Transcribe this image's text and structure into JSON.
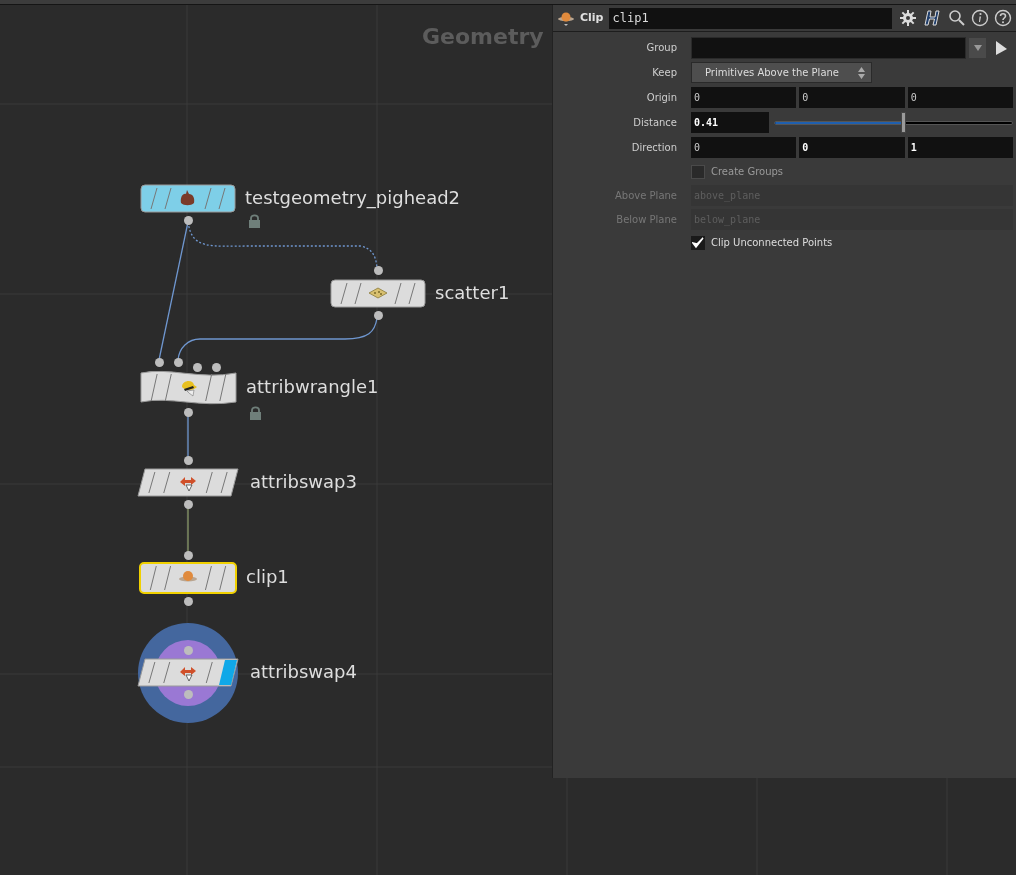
{
  "network": {
    "title": "Geometry",
    "nodes": [
      {
        "kind": "testgeometry",
        "label": "testgeometry_pighead2",
        "color": "#7ecfe8",
        "locked": true,
        "selected": false,
        "display": false
      },
      {
        "kind": "scatter",
        "label": "scatter1",
        "color": "#dcdcdc",
        "locked": false,
        "selected": false,
        "display": false
      },
      {
        "kind": "wrangle",
        "label": "attribwrangle1",
        "color": "#dcdcdc",
        "locked": true,
        "selected": false,
        "display": false
      },
      {
        "kind": "swap",
        "label": "attribswap3",
        "color": "#dcdcdc",
        "locked": false,
        "selected": false,
        "display": false
      },
      {
        "kind": "clip",
        "label": "clip1",
        "color": "#dcdcdc",
        "locked": false,
        "selected": true,
        "display": false
      },
      {
        "kind": "swap",
        "label": "attribswap4",
        "color": "#dcdcdc",
        "locked": false,
        "selected": false,
        "display": true
      }
    ]
  },
  "parameters": {
    "node_type": "Clip",
    "node_name": "clip1",
    "rows": [
      {
        "kind": "group",
        "label": "Group",
        "disabled": false
      },
      {
        "kind": "menu",
        "label": "Keep",
        "value": "Primitives Above the Plane",
        "disabled": false
      },
      {
        "kind": "vector",
        "label": "Origin",
        "disabled": false,
        "components": [
          {
            "value": "0",
            "modified": false
          },
          {
            "value": "0",
            "modified": false
          },
          {
            "value": "0",
            "modified": false
          }
        ]
      },
      {
        "kind": "slider",
        "label": "Distance",
        "value": "0.41",
        "modified": true,
        "level": 0.54,
        "disabled": false
      },
      {
        "kind": "vector",
        "label": "Direction",
        "disabled": false,
        "components": [
          {
            "value": "0",
            "modified": false
          },
          {
            "value": "0",
            "modified": true
          },
          {
            "value": "1",
            "modified": true
          }
        ]
      },
      {
        "kind": "toggle",
        "label": "Create Groups",
        "checked": false,
        "disabled": false
      },
      {
        "kind": "string",
        "label": "Above Plane",
        "value": "above_plane",
        "disabled": true
      },
      {
        "kind": "string",
        "label": "Below Plane",
        "value": "below_plane",
        "disabled": true
      },
      {
        "kind": "toggle",
        "label": "Clip Unconnected Points",
        "checked": true,
        "disabled": false
      }
    ]
  }
}
